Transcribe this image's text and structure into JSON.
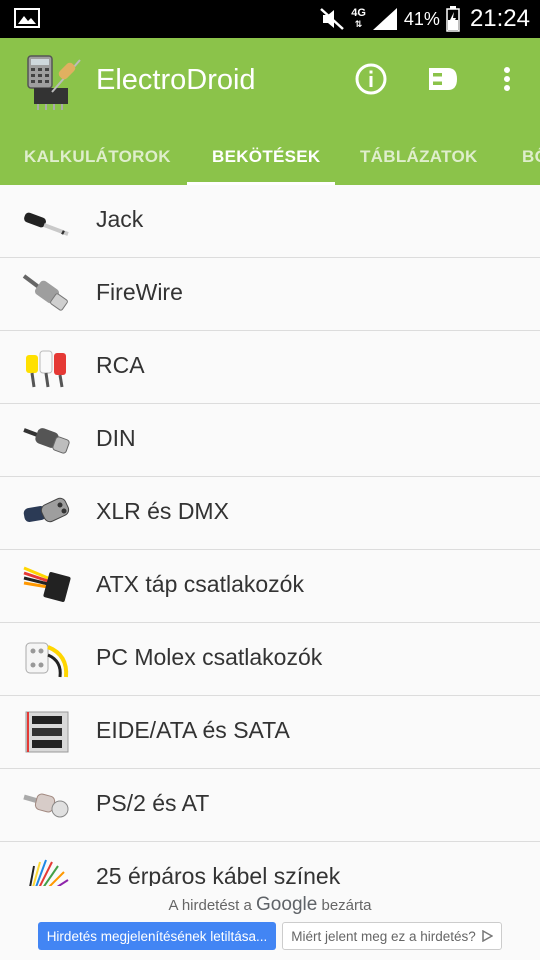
{
  "status_bar": {
    "network": "4G",
    "battery": "41%",
    "time": "21:24"
  },
  "app_bar": {
    "title": "ElectroDroid",
    "icons": [
      "app-logo",
      "info-icon",
      "plug-icon",
      "more-vert-icon"
    ]
  },
  "tabs": [
    {
      "label": "KALKULÁTOROK",
      "active": false
    },
    {
      "label": "BEKÖTÉSEK",
      "active": true
    },
    {
      "label": "TÁBLÁZATOK",
      "active": false
    },
    {
      "label": "BŐ",
      "active": false
    }
  ],
  "list": [
    {
      "label": "Jack",
      "icon": "jack-connector-icon"
    },
    {
      "label": "FireWire",
      "icon": "firewire-connector-icon"
    },
    {
      "label": "RCA",
      "icon": "rca-connector-icon"
    },
    {
      "label": "DIN",
      "icon": "din-connector-icon"
    },
    {
      "label": "XLR és DMX",
      "icon": "xlr-connector-icon"
    },
    {
      "label": "ATX táp csatlakozók",
      "icon": "atx-connector-icon"
    },
    {
      "label": "PC Molex csatlakozók",
      "icon": "molex-connector-icon"
    },
    {
      "label": "EIDE/ATA és SATA",
      "icon": "ide-cable-icon"
    },
    {
      "label": "PS/2 és AT",
      "icon": "ps2-connector-icon"
    },
    {
      "label": "25 érpáros kábel színek",
      "icon": "multicolor-cable-icon"
    }
  ],
  "ad": {
    "closed_prefix": "A hirdetést a",
    "closed_brand": "Google",
    "closed_suffix": "bezárta",
    "stop_button": "Hirdetés megjelenítésének letiltása...",
    "why_button": "Miért jelent meg ez a hirdetés?"
  },
  "colors": {
    "accent": "#8bc34a",
    "status_bar": "#000000",
    "ad_button": "#4285f4"
  }
}
